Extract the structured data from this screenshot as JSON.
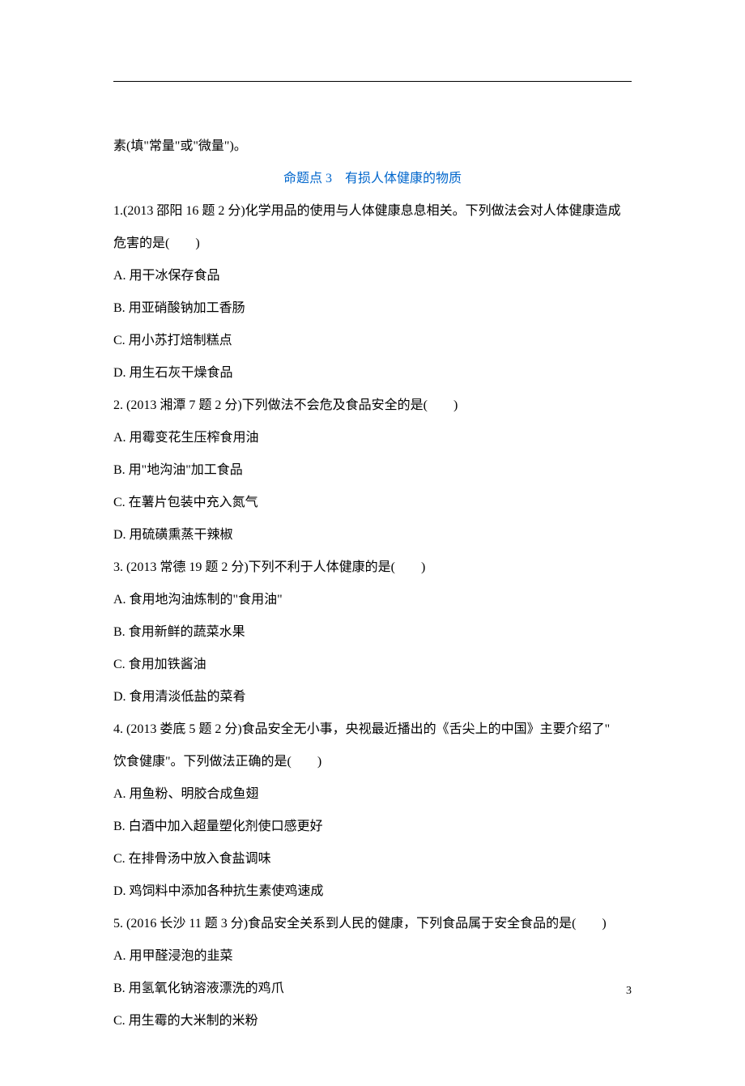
{
  "lines": {
    "intro_continued": "素(填\"常量\"或\"微量\")。",
    "section_title": "命题点 3　有损人体健康的物质",
    "q1_stem": "1.(2013 邵阳 16 题 2 分)化学用品的使用与人体健康息息相关。下列做法会对人体健康造成",
    "q1_stem2": "危害的是(　　)",
    "q1_a": "A. 用干冰保存食品",
    "q1_b": "B. 用亚硝酸钠加工香肠",
    "q1_c": "C. 用小苏打焙制糕点",
    "q1_d": "D. 用生石灰干燥食品",
    "q2_stem": "2. (2013 湘潭 7 题 2 分)下列做法不会危及食品安全的是(　　)",
    "q2_a": "A. 用霉变花生压榨食用油",
    "q2_b": "B. 用\"地沟油\"加工食品",
    "q2_c": "C. 在薯片包装中充入氮气",
    "q2_d": "D. 用硫磺熏蒸干辣椒",
    "q3_stem": "3. (2013 常德 19 题 2 分)下列不利于人体健康的是(　　)",
    "q3_a": "A. 食用地沟油炼制的\"食用油\"",
    "q3_b": "B. 食用新鲜的蔬菜水果",
    "q3_c": "C. 食用加铁酱油",
    "q3_d": "D. 食用清淡低盐的菜肴",
    "q4_stem": "4. (2013 娄底 5 题 2 分)食品安全无小事，央视最近播出的《舌尖上的中国》主要介绍了\"",
    "q4_stem2": "饮食健康\"。下列做法正确的是(　　)",
    "q4_a": "A. 用鱼粉、明胶合成鱼翅",
    "q4_b": "B. 白酒中加入超量塑化剂使口感更好",
    "q4_c": "C. 在排骨汤中放入食盐调味",
    "q4_d": "D. 鸡饲料中添加各种抗生素使鸡速成",
    "q5_stem": "5. (2016 长沙 11 题 3 分)食品安全关系到人民的健康，下列食品属于安全食品的是(　　)",
    "q5_a": "A. 用甲醛浸泡的韭菜",
    "q5_b": "B. 用氢氧化钠溶液漂洗的鸡爪",
    "q5_c": "C. 用生霉的大米制的米粉"
  },
  "page_number": "3"
}
